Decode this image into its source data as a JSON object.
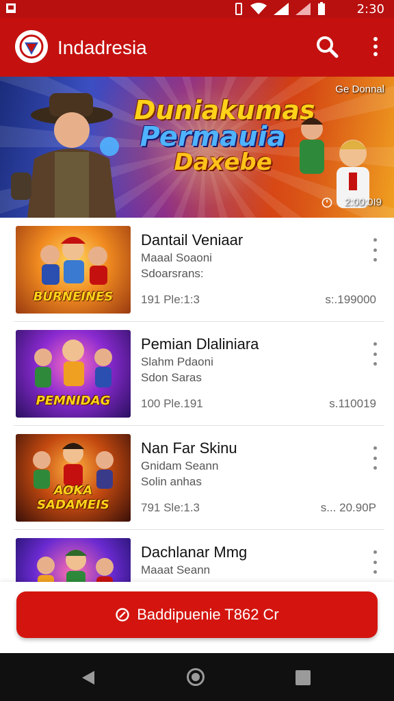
{
  "status_bar": {
    "time": "2:30"
  },
  "app_bar": {
    "title": "Indadresia"
  },
  "banner": {
    "title_line1": "Duniakumas",
    "title_line2": "Permauia",
    "title_line3": "Daxebe",
    "top_right": "Ge Donnal",
    "count": "2:00:0I9"
  },
  "games": [
    {
      "title": "Dantail Veniaar",
      "sub1": "Maaal Soaoni",
      "sub2": "Sdoarsrans:",
      "meta": "191 Ple:1:3",
      "price": "s:.199000",
      "thumb_text": "BURNEINES"
    },
    {
      "title": "Pemian Dlaliniara",
      "sub1": "Slahm Pdaoni",
      "sub2": "Sdon Saras",
      "meta": "100 Ple.191",
      "price": "s.110019",
      "thumb_text": "PEMNIDAG"
    },
    {
      "title": "Nan Far Skinu",
      "sub1": "Gnidam Seann",
      "sub2": "Solin anhas",
      "meta": "791 Sle:1.3",
      "price": "s... 20.90P",
      "thumb_text": "AOKA SADAMEIS"
    },
    {
      "title": "Dachlanar Mmg",
      "sub1": "Maaat Seann",
      "sub2": "",
      "meta": "",
      "price": "",
      "thumb_text": ""
    }
  ],
  "cta": {
    "label": "Baddipuenie T862 Cr"
  },
  "colors": {
    "primary": "#c4110f",
    "cta": "#d4150f",
    "status_bar": "#b80f0f"
  }
}
